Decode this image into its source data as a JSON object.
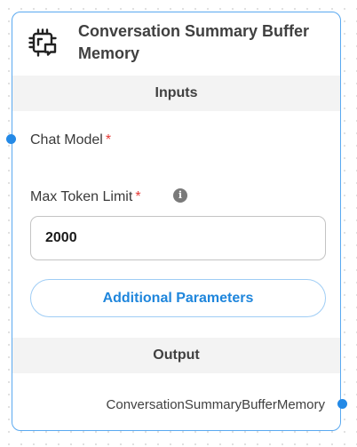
{
  "node": {
    "title": "Conversation Summary Buffer Memory",
    "icon": "memory-chip-chat-icon",
    "accent_color": "#2389e6"
  },
  "inputs": {
    "header": "Inputs",
    "chat_model_label": "Chat Model",
    "max_token_limit_label": "Max Token Limit",
    "required_marker": "*",
    "max_token_limit_value": "2000",
    "info_icon": "info-icon",
    "additional_params_label": "Additional Parameters"
  },
  "output": {
    "header": "Output",
    "label": "ConversationSummaryBufferMemory"
  }
}
